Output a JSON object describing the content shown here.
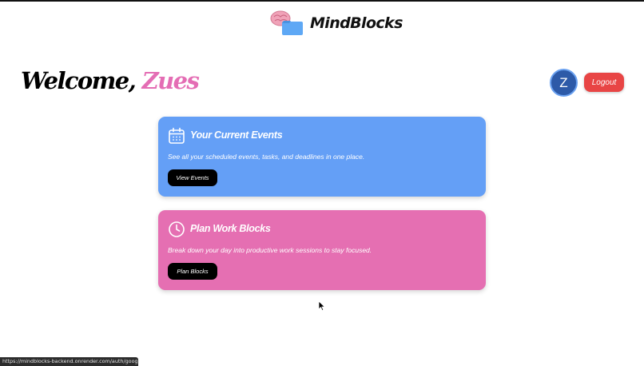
{
  "brand": {
    "title": "MindBlocks",
    "logo_icon": "brain-folder-logo"
  },
  "welcome": {
    "greeting": "Welcome,",
    "username": "Zues"
  },
  "user": {
    "avatar_letter": "Z",
    "logout_label": "Logout"
  },
  "cards": [
    {
      "title": "Your Current Events",
      "description": "See all your scheduled events, tasks, and deadlines in one place.",
      "button_label": "View Events",
      "icon": "calendar-icon",
      "color": "#649ff6"
    },
    {
      "title": "Plan Work Blocks",
      "description": "Break down your day into productive work sessions to stay focused.",
      "button_label": "Plan Blocks",
      "icon": "clock-icon",
      "color": "#e56fb2"
    }
  ],
  "colors": {
    "accent_pink": "#e46db4",
    "logout_red": "#e84545",
    "avatar_blue": "#2d5aa8"
  },
  "status_bar": {
    "url": "https://mindblocks-backend.onrender.com/auth/google"
  }
}
